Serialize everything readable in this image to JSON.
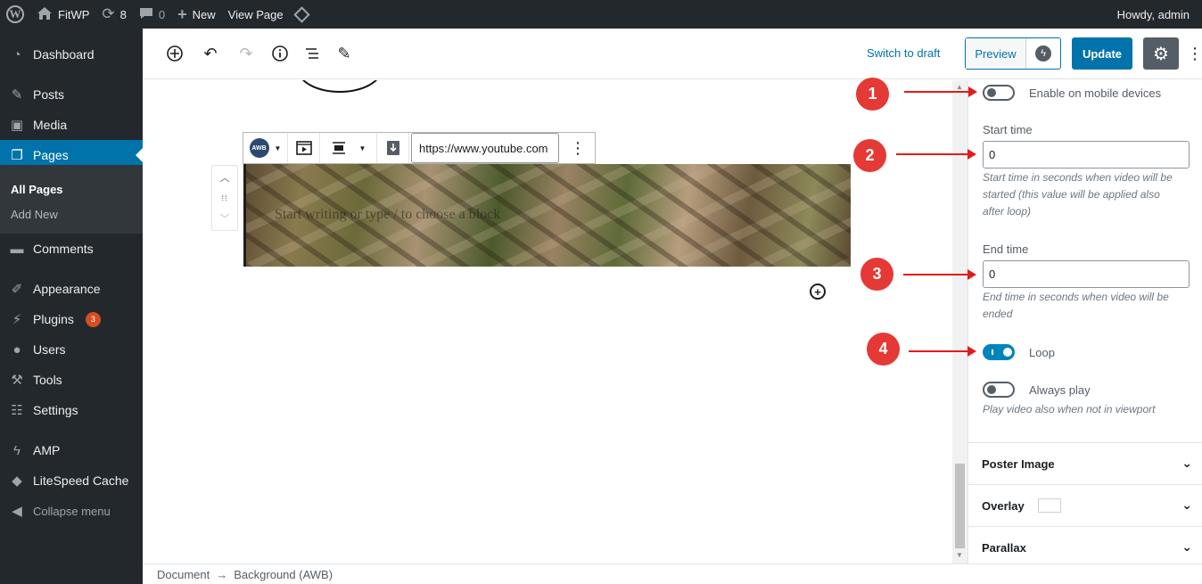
{
  "adminbar": {
    "site_name": "FitWP",
    "updates_count": "8",
    "comments_count": "0",
    "new_label": "New",
    "view_page_label": "View Page",
    "howdy": "Howdy, admin"
  },
  "sidebar": {
    "dashboard": "Dashboard",
    "posts": "Posts",
    "media": "Media",
    "pages": "Pages",
    "all_pages": "All Pages",
    "add_new": "Add New",
    "comments": "Comments",
    "appearance": "Appearance",
    "plugins": "Plugins",
    "plugins_badge": "3",
    "users": "Users",
    "tools": "Tools",
    "settings": "Settings",
    "amp": "AMP",
    "litespeed": "LiteSpeed Cache",
    "collapse": "Collapse menu"
  },
  "toolbar": {
    "switch_to_draft": "Switch to draft",
    "preview": "Preview",
    "update": "Update"
  },
  "block": {
    "awb_logo_text": "AWB",
    "url_value": "https://www.youtube.com",
    "placeholder": "Start writing or type / to choose a block"
  },
  "panel": {
    "enable_mobile_label": "Enable on mobile devices",
    "start_time_label": "Start time",
    "start_time_value": "0",
    "start_time_help": "Start time in seconds when video will be started (this value will be applied also after loop)",
    "end_time_label": "End time",
    "end_time_value": "0",
    "end_time_help": "End time in seconds when video will be ended",
    "loop_label": "Loop",
    "always_play_label": "Always play",
    "always_play_help": "Play video also when not in viewport",
    "poster_image": "Poster Image",
    "overlay": "Overlay",
    "parallax": "Parallax"
  },
  "toggles": {
    "enable_mobile": false,
    "loop": true,
    "always_play": false
  },
  "annotations": [
    "1",
    "2",
    "3",
    "4"
  ],
  "annotation_color": "#e53935",
  "accent_color": "#0073aa",
  "breadcrumb": {
    "document": "Document",
    "separator": "→",
    "current": "Background (AWB)"
  }
}
